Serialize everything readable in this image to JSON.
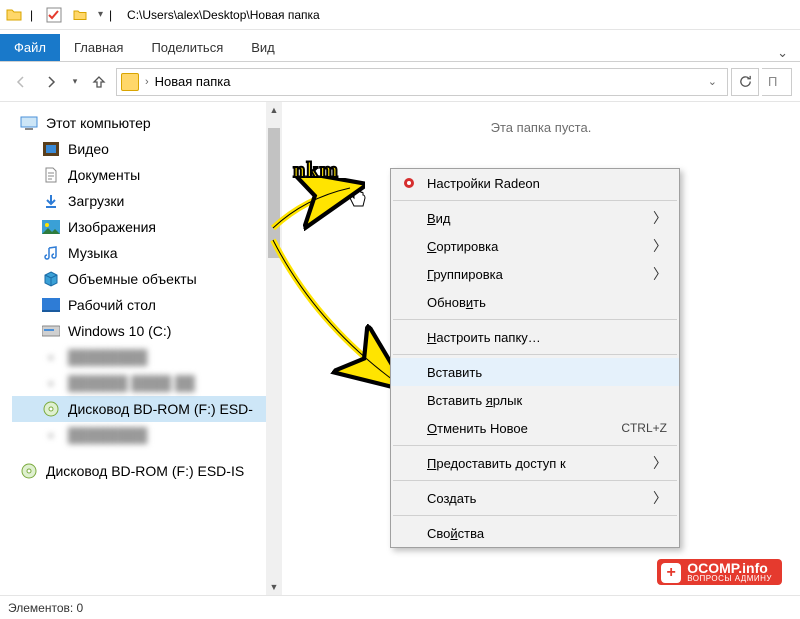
{
  "titlebar": {
    "path": "C:\\Users\\alex\\Desktop\\Новая папка"
  },
  "ribbon": {
    "file": "Файл",
    "home": "Главная",
    "share": "Поделиться",
    "view": "Вид"
  },
  "address": {
    "label": "Новая папка"
  },
  "search": {
    "stub": "П"
  },
  "sidebar": {
    "root": "Этот компьютер",
    "items": [
      {
        "label": "Видео"
      },
      {
        "label": "Документы"
      },
      {
        "label": "Загрузки"
      },
      {
        "label": "Изображения"
      },
      {
        "label": "Музыка"
      },
      {
        "label": "Объемные объекты"
      },
      {
        "label": "Рабочий стол"
      },
      {
        "label": "Windows 10 (C:)"
      },
      {
        "label": "blurred-item-1"
      },
      {
        "label": "blurred-item-2"
      },
      {
        "label": "Дисковод BD-ROM (F:) ESD-"
      },
      {
        "label": "blurred-item-3"
      }
    ],
    "second_root": "Дисковод BD-ROM (F:) ESD-IS"
  },
  "content": {
    "empty": "Эта папка пуста."
  },
  "statusbar": {
    "count": "Элементов: 0"
  },
  "annotation": {
    "pkm": "nkm"
  },
  "context_menu": {
    "radeon": "Настройки Radeon",
    "view": "Вид",
    "sort": "Сортировка",
    "group": "Группировка",
    "refresh": "Обновить",
    "customize": "Настроить папку…",
    "paste": "Вставить",
    "paste_shortcut": "Вставить ярлык",
    "undo": "Отменить Новое",
    "undo_shortcut": "CTRL+Z",
    "share_access": "Предоставить доступ к",
    "new": "Создать",
    "properties": "Свойства"
  },
  "watermark": {
    "main": "OCOMP.info",
    "sub": "ВОПРОСЫ АДМИНУ"
  }
}
